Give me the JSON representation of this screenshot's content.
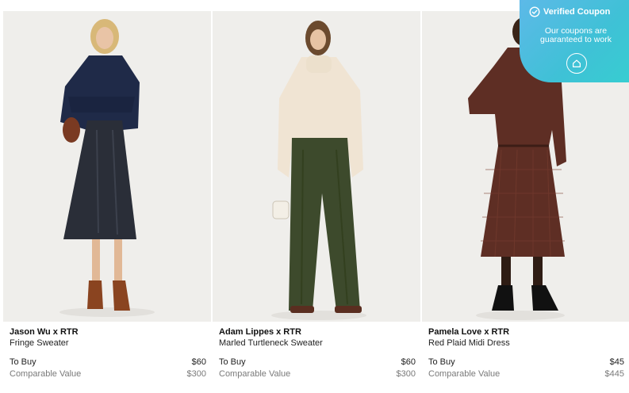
{
  "products": [
    {
      "brand": "Jason Wu x RTR",
      "name": "Fringe Sweater",
      "buy_label": "To Buy",
      "buy_price": "$60",
      "comparable_label": "Comparable Value",
      "comparable_price": "$300"
    },
    {
      "brand": "Adam Lippes x RTR",
      "name": "Marled Turtleneck Sweater",
      "buy_label": "To Buy",
      "buy_price": "$60",
      "comparable_label": "Comparable Value",
      "comparable_price": "$300"
    },
    {
      "brand": "Pamela Love x RTR",
      "name": "Red Plaid Midi Dress",
      "buy_label": "To Buy",
      "buy_price": "$45",
      "comparable_label": "Comparable Value",
      "comparable_price": "$445"
    }
  ],
  "coupon_badge": {
    "title": "Verified Coupon",
    "description": "Our coupons are guaranteed to work",
    "icons": [
      "check-circle-icon",
      "home-icon"
    ],
    "gradient": [
      "#5db9e8",
      "#37cdd1"
    ]
  },
  "colors": {
    "photo_background": "#efeeeb",
    "price_gray": "#7a7a7a"
  }
}
